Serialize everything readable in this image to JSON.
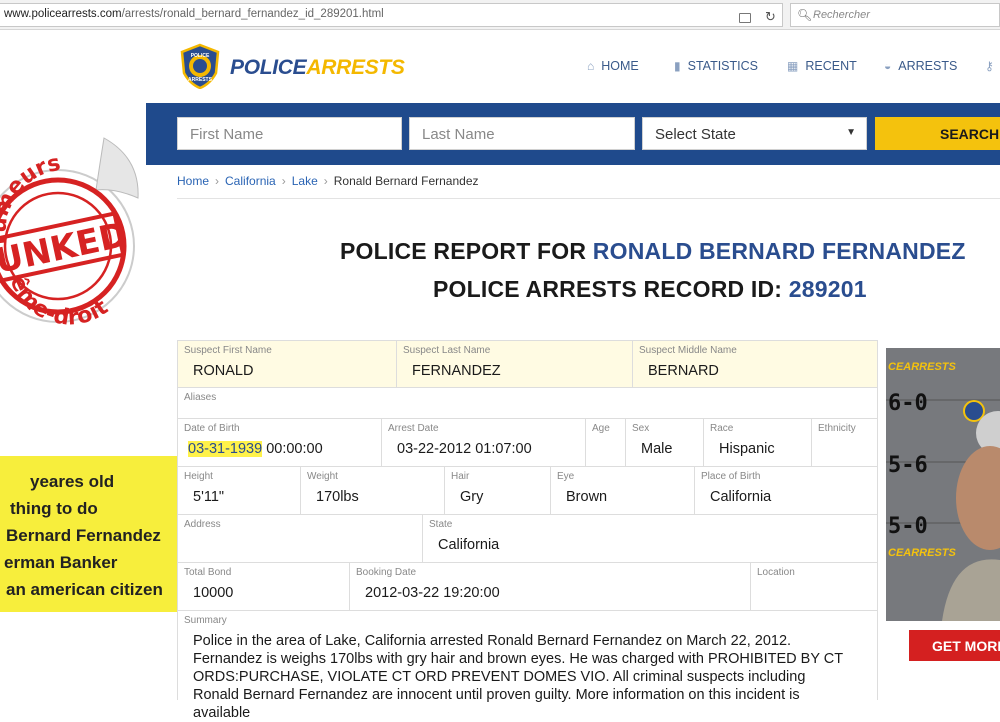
{
  "browser": {
    "url_host": "www.policearrests.com",
    "url_path": "/arrests/ronald_bernard_fernandez_id_289201.html",
    "search_placeholder": "Rechercher"
  },
  "site": {
    "logo_part1": "POLICE",
    "logo_part2": "ARRESTS",
    "badge_text_top": "POLICE",
    "badge_text_bottom": "ARRESTS",
    "nav": [
      "HOME",
      "STATISTICS",
      "RECENT",
      "ARRESTS"
    ]
  },
  "search": {
    "first_name_placeholder": "First Name",
    "last_name_placeholder": "Last Name",
    "state_selected": "Select State",
    "button": "SEARCH N"
  },
  "breadcrumb": [
    "Home",
    "California",
    "Lake",
    "Ronald Bernard Fernandez"
  ],
  "title": {
    "line1_prefix": "POLICE REPORT FOR",
    "line1_name": "RONALD BERNARD FERNANDEZ",
    "line2_prefix": "POLICE ARRESTS RECORD ID:",
    "line2_id": "289201"
  },
  "record": {
    "first_name_label": "Suspect First Name",
    "first_name": "RONALD",
    "last_name_label": "Suspect Last Name",
    "last_name": "FERNANDEZ",
    "middle_name_label": "Suspect Middle Name",
    "middle_name": "BERNARD",
    "aliases_label": "Aliases",
    "dob_label": "Date of Birth",
    "dob_date": "03-31-1939",
    "dob_time": " 00:00:00",
    "arrest_date_label": "Arrest Date",
    "arrest_date": "03-22-2012 01:07:00",
    "age_label": "Age",
    "sex_label": "Sex",
    "sex": "Male",
    "race_label": "Race",
    "race": "Hispanic",
    "ethnicity_label": "Ethnicity",
    "height_label": "Height",
    "height": "5'11\"",
    "weight_label": "Weight",
    "weight": "170lbs",
    "hair_label": "Hair",
    "hair": "Gry",
    "eye_label": "Eye",
    "eye": "Brown",
    "pob_label": "Place of Birth",
    "pob": "California",
    "address_label": "Address",
    "state_label": "State",
    "state": "California",
    "bond_label": "Total Bond",
    "bond": "10000",
    "booking_label": "Booking Date",
    "booking": "2012-03-22 19:20:00",
    "location_label": "Location",
    "summary_label": "Summary",
    "summary": "Police in the area of Lake, California arrested Ronald Bernard Fernandez on March 22, 2012. Fernandez is weighs 170lbs with gry hair and brown eyes. He was charged with PROHIBITED BY CT ORDS:PURCHASE, VIOLATE CT ORD PREVENT DOMES VIO.  All criminal suspects including Ronald Bernard Fernandez are innocent until proven guilty. More information on this incident is available"
  },
  "overlay": {
    "stamp_top": "rumeurs",
    "stamp_middle": "UNKED",
    "stamp_bottom": "ême-droite",
    "notice_lines": [
      "yeares old",
      "thing to do",
      "Bernard Fernandez",
      "erman Banker",
      "an american citizen"
    ]
  },
  "mugshot": {
    "height_marks": [
      "6-0",
      "5-6",
      "5-0"
    ],
    "watermark": "CEARRESTS",
    "badge_text": "Po"
  },
  "get_more_button": "GET MORE",
  "colors": {
    "brand_blue": "#1f4a8c",
    "brand_yellow": "#f4c20d",
    "cta_red": "#d42020",
    "link": "#2a64b4"
  }
}
